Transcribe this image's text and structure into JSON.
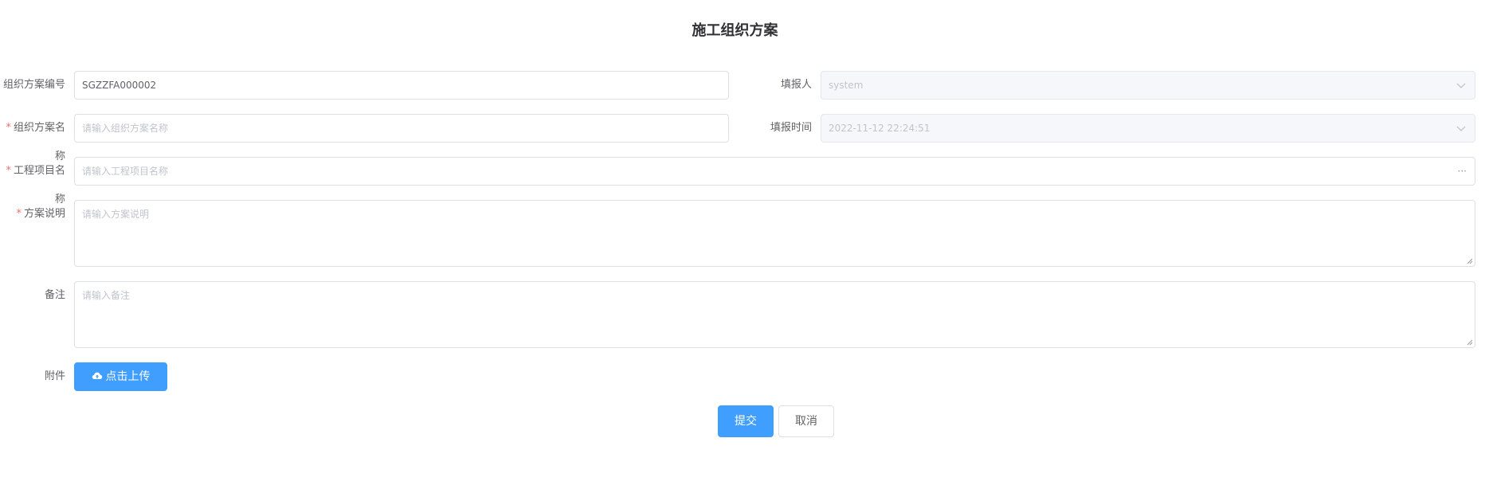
{
  "page": {
    "title": "施工组织方案"
  },
  "form": {
    "plan_code": {
      "label": "组织方案编号",
      "value": "SGZZFA000002"
    },
    "reporter": {
      "label": "填报人",
      "value": "system"
    },
    "plan_name": {
      "label": "组织方案名称",
      "placeholder": "请输入组织方案名称",
      "required": "*"
    },
    "report_time": {
      "label": "填报时间",
      "value": "2022-11-12 22:24:51"
    },
    "project_name": {
      "label": "工程项目名称",
      "placeholder": "请输入工程项目名称",
      "required": "*",
      "picker_glyph": "···"
    },
    "plan_desc": {
      "label": "方案说明",
      "placeholder": "请输入方案说明",
      "required": "*"
    },
    "remark": {
      "label": "备注",
      "placeholder": "请输入备注"
    },
    "attachment": {
      "label": "附件",
      "upload_label": "点击上传"
    }
  },
  "actions": {
    "submit_label": "提交",
    "cancel_label": "取消"
  },
  "icons": {
    "upload": "cloud-upload-icon",
    "select": "chevron-down-icon",
    "picker": "more-icon"
  },
  "colors": {
    "primary": "#409eff",
    "required": "#f56c6c",
    "border": "#dcdfe6",
    "disabled_bg": "#f5f7fa"
  }
}
